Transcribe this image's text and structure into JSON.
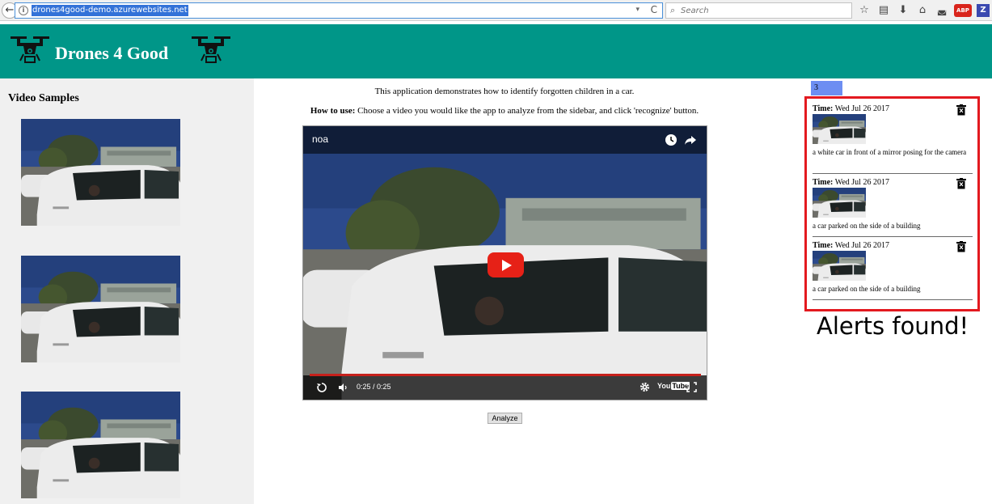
{
  "browser": {
    "url": "drones4good-demo.azurewebsites.net",
    "search_placeholder": "Search",
    "back_glyph": "←",
    "dropdown_glyph": "▾",
    "reload_glyph": "C",
    "search_glyph": "⌕",
    "toolbar_icons": [
      "star-icon",
      "reading-list-icon",
      "download-icon",
      "home-icon",
      "pocket-icon",
      "adblock-icon",
      "z-extension-icon"
    ],
    "abp_label": "ABP",
    "z_label": "Z"
  },
  "header": {
    "title": "Drones 4 Good",
    "bg_color": "#009688"
  },
  "sidebar": {
    "title": "Video Samples",
    "bg_color": "#f0f0f0"
  },
  "main": {
    "intro": "This application demonstrates how to identify forgotten children in a car.",
    "howto_label": "How to use:",
    "howto_text": " Choose a video you would like the app to analyze from the sidebar, and click 'recognize' button.",
    "video": {
      "title": "noa",
      "time": "0:25 / 0:25",
      "played_fraction": 1.0,
      "logo_you": "You",
      "logo_tube": "Tube"
    },
    "analyze_label": "Analyze"
  },
  "alerts": {
    "count": "3",
    "time_label": "Time:",
    "items": [
      {
        "time": " Wed Jul 26 2017",
        "caption": "a white car in front of a mirror posing for the camera"
      },
      {
        "time": " Wed Jul 26 2017",
        "caption": "a car parked on the side of a building"
      },
      {
        "time": " Wed Jul 26 2017",
        "caption": "a car parked on the side of a building"
      }
    ],
    "annotation": "Alerts found!",
    "border_color": "#e3191f",
    "badge_color": "#6d8ef2"
  }
}
